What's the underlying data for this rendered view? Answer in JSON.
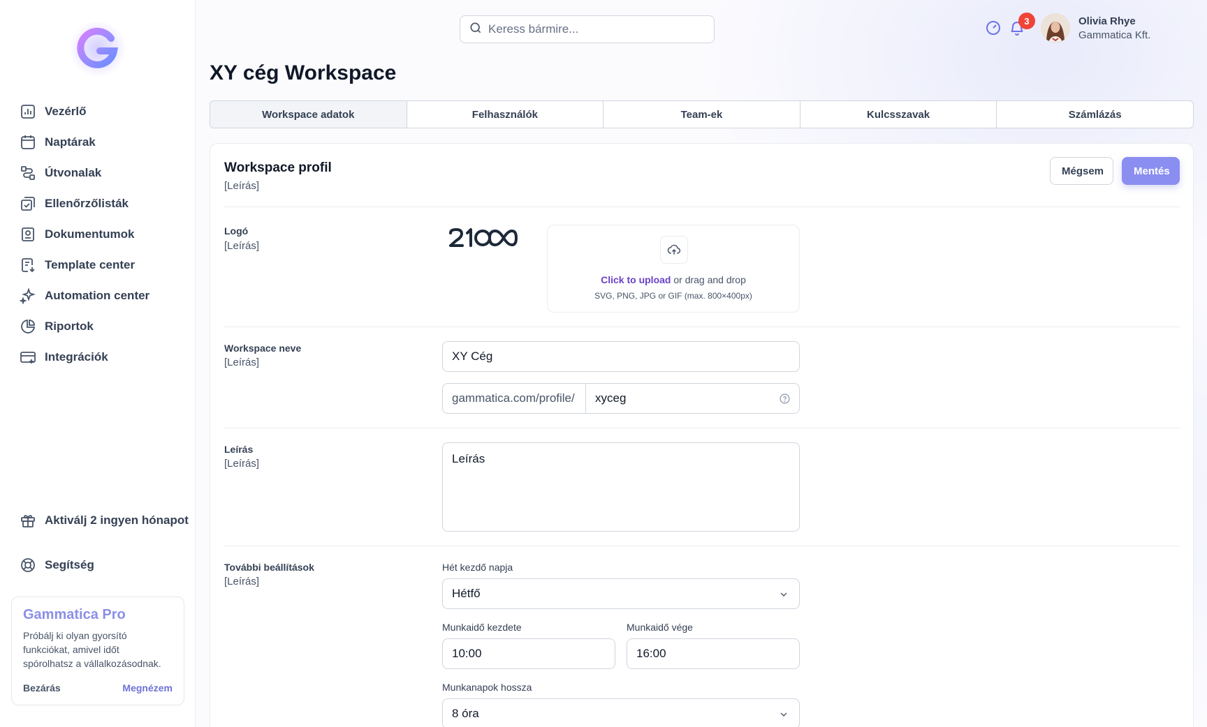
{
  "sidebar": {
    "nav": [
      {
        "label": "Vezérlő",
        "icon": "bar-chart-icon"
      },
      {
        "label": "Naptárak",
        "icon": "calendar-icon"
      },
      {
        "label": "Útvonalak",
        "icon": "route-icon"
      },
      {
        "label": "Ellenőrzőlisták",
        "icon": "checklist-icon"
      },
      {
        "label": "Dokumentumok",
        "icon": "document-icon"
      },
      {
        "label": "Template center",
        "icon": "template-icon"
      },
      {
        "label": "Automation center",
        "icon": "sparkles-icon"
      },
      {
        "label": "Riportok",
        "icon": "pie-chart-icon"
      },
      {
        "label": "Integrációk",
        "icon": "integration-icon"
      }
    ],
    "gift_label": "Aktiválj 2 ingyen hónapot",
    "help_label": "Segítség",
    "promo": {
      "title": "Gammatica Pro",
      "text": "Próbálj ki olyan gyorsító funkciókat, amivel időt spórolhatsz a vállalkozásodnak.",
      "close": "Bezárás",
      "cta": "Megnézem"
    }
  },
  "header": {
    "search_placeholder": "Keress bármire...",
    "notification_count": "3",
    "user_name": "Olivia Rhye",
    "user_company": "Gammatica Kft."
  },
  "page_title": "XY cég Workspace",
  "tabs": [
    "Workspace adatok",
    "Felhasználók",
    "Team-ek",
    "Kulcsszavak",
    "Számlázás"
  ],
  "card": {
    "title": "Workspace profil",
    "subtitle": "[Leírás]",
    "cancel": "Mégsem",
    "save": "Mentés"
  },
  "logo_section": {
    "label": "Logó",
    "desc": "[Leírás]",
    "brand": "2100",
    "upload_link": "Click to upload",
    "upload_rest": " or drag and drop",
    "upload_hint": "SVG, PNG, JPG or GIF (max. 800×400px)"
  },
  "name_section": {
    "label": "Workspace neve",
    "desc": "[Leírás]",
    "name_value": "XY Cég",
    "url_prefix": "gammatica.com/profile/",
    "url_value": "xyceg"
  },
  "desc_section": {
    "label": "Leírás",
    "desc": "[Leírás]",
    "value": "Leírás"
  },
  "settings_section": {
    "label": "További beállítások",
    "desc": "[Leírás]",
    "week_start_label": "Hét kezdő napja",
    "week_start_value": "Hétfő",
    "work_start_label": "Munkaidő kezdete",
    "work_start_value": "10:00",
    "work_end_label": "Munkaidő vége",
    "work_end_value": "16:00",
    "day_length_label": "Munkanapok hossza",
    "day_length_value": "8 óra"
  },
  "colors": {
    "accent": "#8a8ef0",
    "link": "#6941c6",
    "badge": "#f04438",
    "promo_title": "#8b8fe6"
  }
}
